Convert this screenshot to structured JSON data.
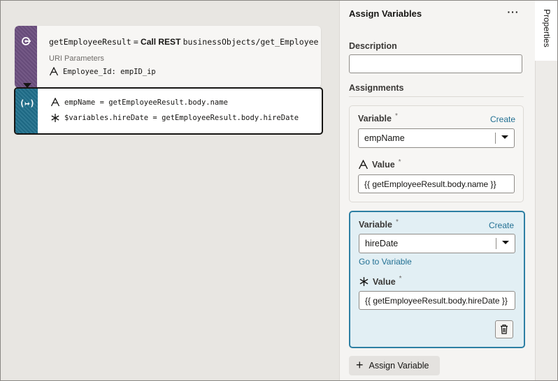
{
  "canvas": {
    "node1": {
      "icon": "rest-call-icon",
      "result_var": "getEmployeeResult",
      "equals": "=",
      "action": "Call REST",
      "endpoint": "businessObjects/get_Employee",
      "section_label": "URI Parameters",
      "param": "Employee_Id: empID_ip",
      "param_icon": "text-type-icon"
    },
    "node2": {
      "icon": "assign-variables-icon",
      "icon_text": "(↦)",
      "lines": [
        {
          "icon": "text-type-icon",
          "text": "empName = getEmployeeResult.body.name"
        },
        {
          "icon": "any-type-icon",
          "text": "$variables.hireDate = getEmployeeResult.body.hireDate"
        }
      ]
    }
  },
  "panel": {
    "title": "Assign Variables",
    "menu": "···",
    "description_label": "Description",
    "description_value": "",
    "assignments_label": "Assignments",
    "assignments": [
      {
        "variable_label": "Variable",
        "required": "*",
        "create_link": "Create",
        "variable_value": "empName",
        "value_label": "Value",
        "value_icon": "text-type-icon",
        "value": "{{ getEmployeeResult.body.name }}"
      },
      {
        "variable_label": "Variable",
        "required": "*",
        "create_link": "Create",
        "variable_value": "hireDate",
        "goto_link": "Go to Variable",
        "value_label": "Value",
        "value_icon": "any-type-icon",
        "value": "{{ getEmployeeResult.body.hireDate }}"
      }
    ],
    "add_button": "Assign Variable"
  },
  "sidebar": {
    "tab_label": "Properties"
  },
  "colors": {
    "rest_strip": "#6c4f7f",
    "assign_strip": "#1f6f8b",
    "link": "#227093",
    "selected_border": "#2d7fa3"
  }
}
